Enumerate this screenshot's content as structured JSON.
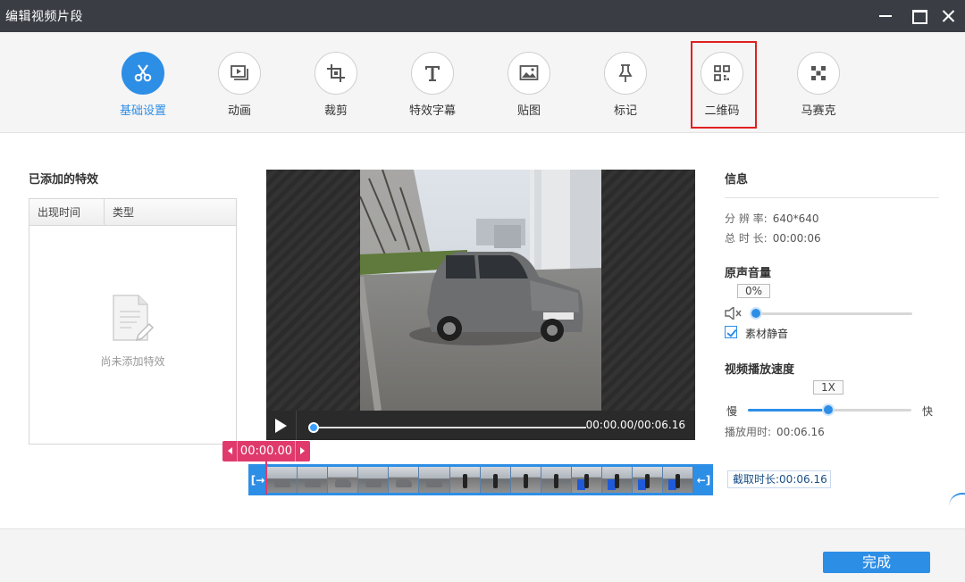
{
  "window": {
    "title": "编辑视频片段"
  },
  "toolbar": {
    "tools": [
      {
        "label": "基础设置",
        "icon": "scissors-icon",
        "active": true
      },
      {
        "label": "动画",
        "icon": "animation-icon"
      },
      {
        "label": "裁剪",
        "icon": "crop-icon"
      },
      {
        "label": "特效字幕",
        "icon": "text-icon"
      },
      {
        "label": "贴图",
        "icon": "image-icon"
      },
      {
        "label": "标记",
        "icon": "pin-icon"
      },
      {
        "label": "二维码",
        "icon": "qrcode-icon",
        "highlighted": true
      },
      {
        "label": "马赛克",
        "icon": "mosaic-icon"
      }
    ]
  },
  "effects": {
    "title": "已添加的特效",
    "columns": [
      "出现时间",
      "类型"
    ],
    "empty_text": "尚未添加特效"
  },
  "player": {
    "time": "00:00.00/00:06.16",
    "progress": 0
  },
  "timeline": {
    "current_time": "00:00.00",
    "left_handle": "[→",
    "right_handle": "←]",
    "clip_length": "截取时长:00:06.16"
  },
  "info": {
    "title": "信息",
    "resolution_label": "分 辨 率:",
    "resolution": "640*640",
    "duration_label": "总 时 长:",
    "duration": "00:00:06"
  },
  "volume": {
    "title": "原声音量",
    "value": "0%",
    "level": 0,
    "mute_label": "素材静音",
    "mute_checked": true
  },
  "speed": {
    "title": "视频播放速度",
    "value": "1X",
    "slow": "慢",
    "fast": "快",
    "level": 0.5,
    "playtime_label": "播放用时:",
    "playtime": "00:06.16"
  },
  "footer": {
    "done_label": "完成"
  },
  "colors": {
    "accent": "#2d8ee6",
    "marker": "#e03a6c",
    "highlight": "#e02020",
    "titlebar": "#3a3d43"
  }
}
